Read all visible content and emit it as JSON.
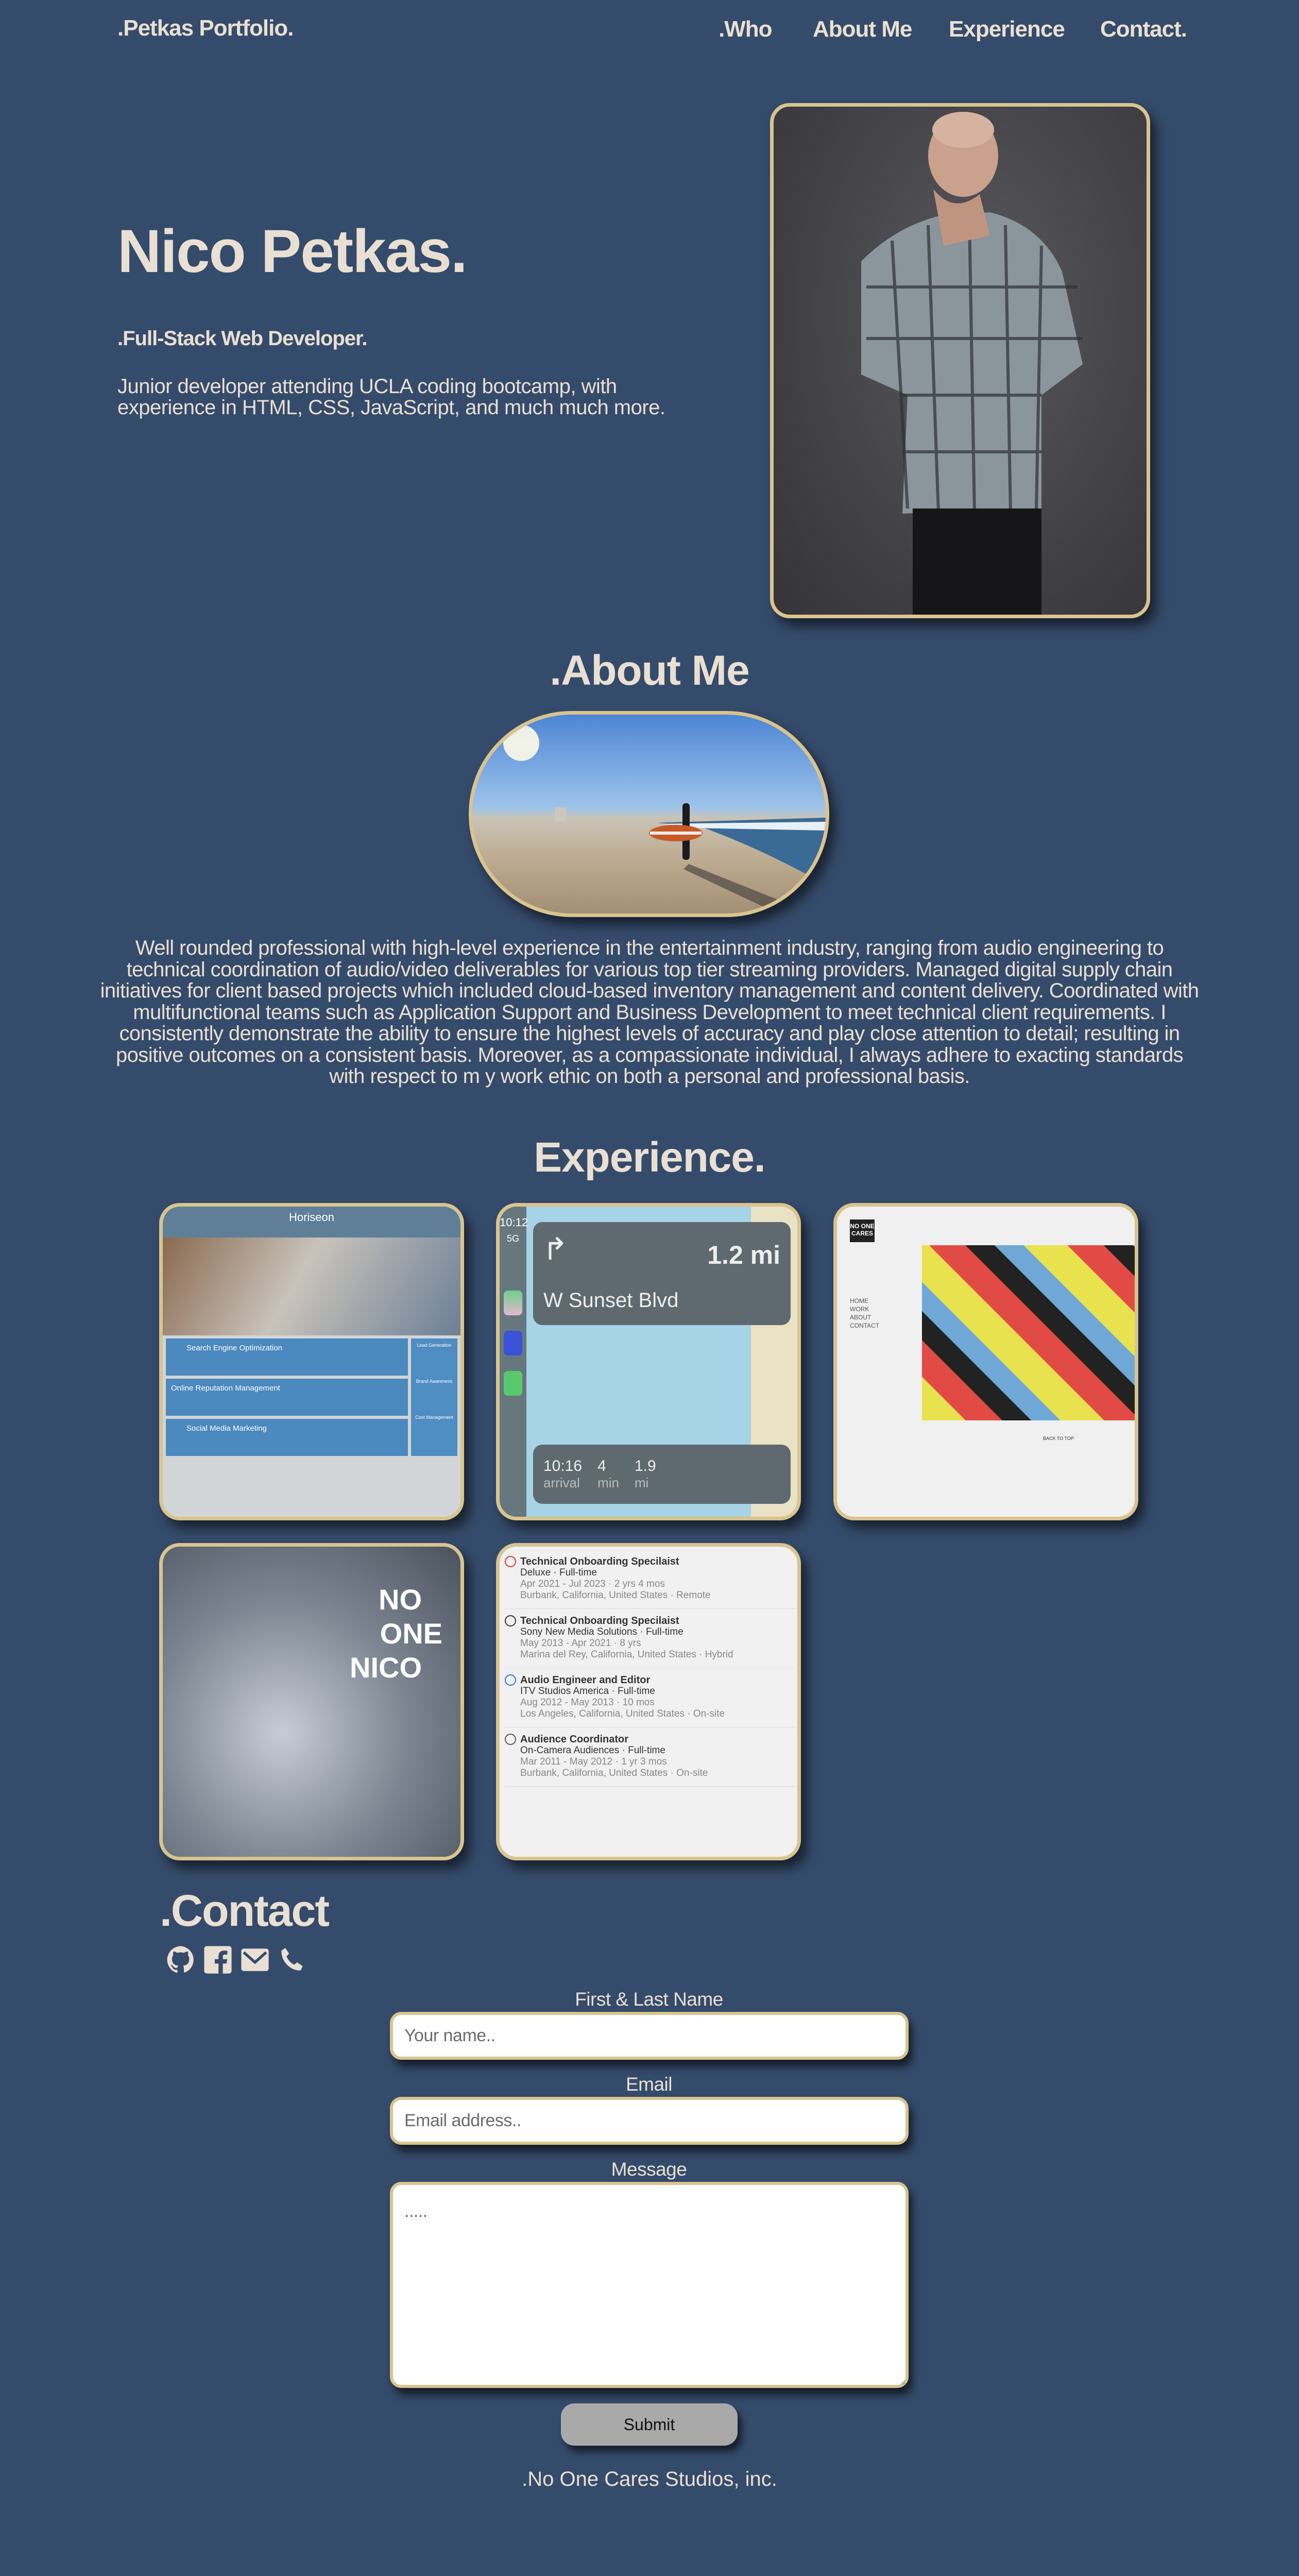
{
  "nav": {
    "logo": ".Petkas Portfolio.",
    "items": [
      ".Who",
      "About Me",
      "Experience",
      "Contact."
    ]
  },
  "hero": {
    "title": "Nico Petkas.",
    "subtitle": ".Full-Stack Web Developer.",
    "description": "Junior developer attending UCLA coding bootcamp, with experience in HTML, CSS, JavaScript, and much much more."
  },
  "about": {
    "heading": ".About Me",
    "text": "Well rounded professional with high-level experience in the entertainment industry, ranging from audio engineering to technical coordination of audio/video deliverables for various top tier streaming providers. Managed digital supply chain initiatives for client based projects which included cloud-based inventory management and content delivery. Coordinated with multifunctional teams such as Application Support and Business Development to meet technical client requirements. I consistently demonstrate the ability to ensure the highest levels of accuracy and play close attention to detail; resulting in positive outcomes on a consistent basis. Moreover, as a compassionate individual, I always adhere to exacting standards with respect to m y work ethic on both a personal and professional basis."
  },
  "experience": {
    "heading": "Experience.",
    "cards": [
      {
        "type": "website",
        "title": "Horiseon",
        "sections": [
          "Search Engine Optimization",
          "Online Reputation Management",
          "Social Media Marketing"
        ],
        "sidebar": [
          "Lead Generation",
          "Brand Awareness",
          "Cost Management"
        ]
      },
      {
        "type": "navigation",
        "time": "10:12",
        "signal": "5G",
        "distance": "1.2 mi",
        "street": "W Sunset Blvd",
        "arrival": "10:16",
        "arrival_label": "arrival",
        "minutes": "4",
        "minutes_label": "min",
        "miles": "1.9",
        "miles_label": "mi"
      },
      {
        "type": "website",
        "logo": "NO ONE CARES",
        "menu": [
          "HOME",
          "WORK",
          "ABOUT",
          "CONTACT"
        ],
        "back_to_top": "BACK TO TOP"
      },
      {
        "type": "artwork",
        "text": [
          "NO",
          "ONE",
          "NICO"
        ]
      },
      {
        "type": "resume",
        "jobs": [
          {
            "title": "Technical Onboarding Specilaist",
            "company": "Deluxe · Full-time",
            "dates": "Apr 2021 - Jul 2023 · 2 yrs 4 mos",
            "location": "Burbank, California, United States · Remote"
          },
          {
            "title": "Technical Onboarding Specilaist",
            "company": "Sony New Media Solutions · Full-time",
            "dates": "May 2013 - Apr 2021 · 8 yrs",
            "location": "Marina del Rey, California, United States · Hybrid"
          },
          {
            "title": "Audio Engineer and Editor",
            "company": "ITV Studios America · Full-time",
            "dates": "Aug 2012 - May 2013 · 10 mos",
            "location": "Los Angeles, California, United States · On-site"
          },
          {
            "title": "Audience Coordinator",
            "company": "On-Camera Audiences · Full-time",
            "dates": "Mar 2011 - May 2012 · 1 yr 3 mos",
            "location": "Burbank, California, United States · On-site"
          }
        ]
      }
    ]
  },
  "contact": {
    "heading": ".Contact",
    "icons": [
      "github-icon",
      "facebook-icon",
      "email-icon",
      "phone-icon"
    ],
    "name_label": "First & Last Name",
    "name_placeholder": "Your name..",
    "email_label": "Email",
    "email_placeholder": "Email address..",
    "message_label": "Message",
    "message_placeholder": ".....",
    "submit": "Submit"
  },
  "footer": {
    "text": ".No One Cares Studios, inc."
  },
  "colors": {
    "background": "#354b6b",
    "text": "#e9e0d3",
    "accent_border": "#d9c48e",
    "button": "#aaa9aa"
  }
}
